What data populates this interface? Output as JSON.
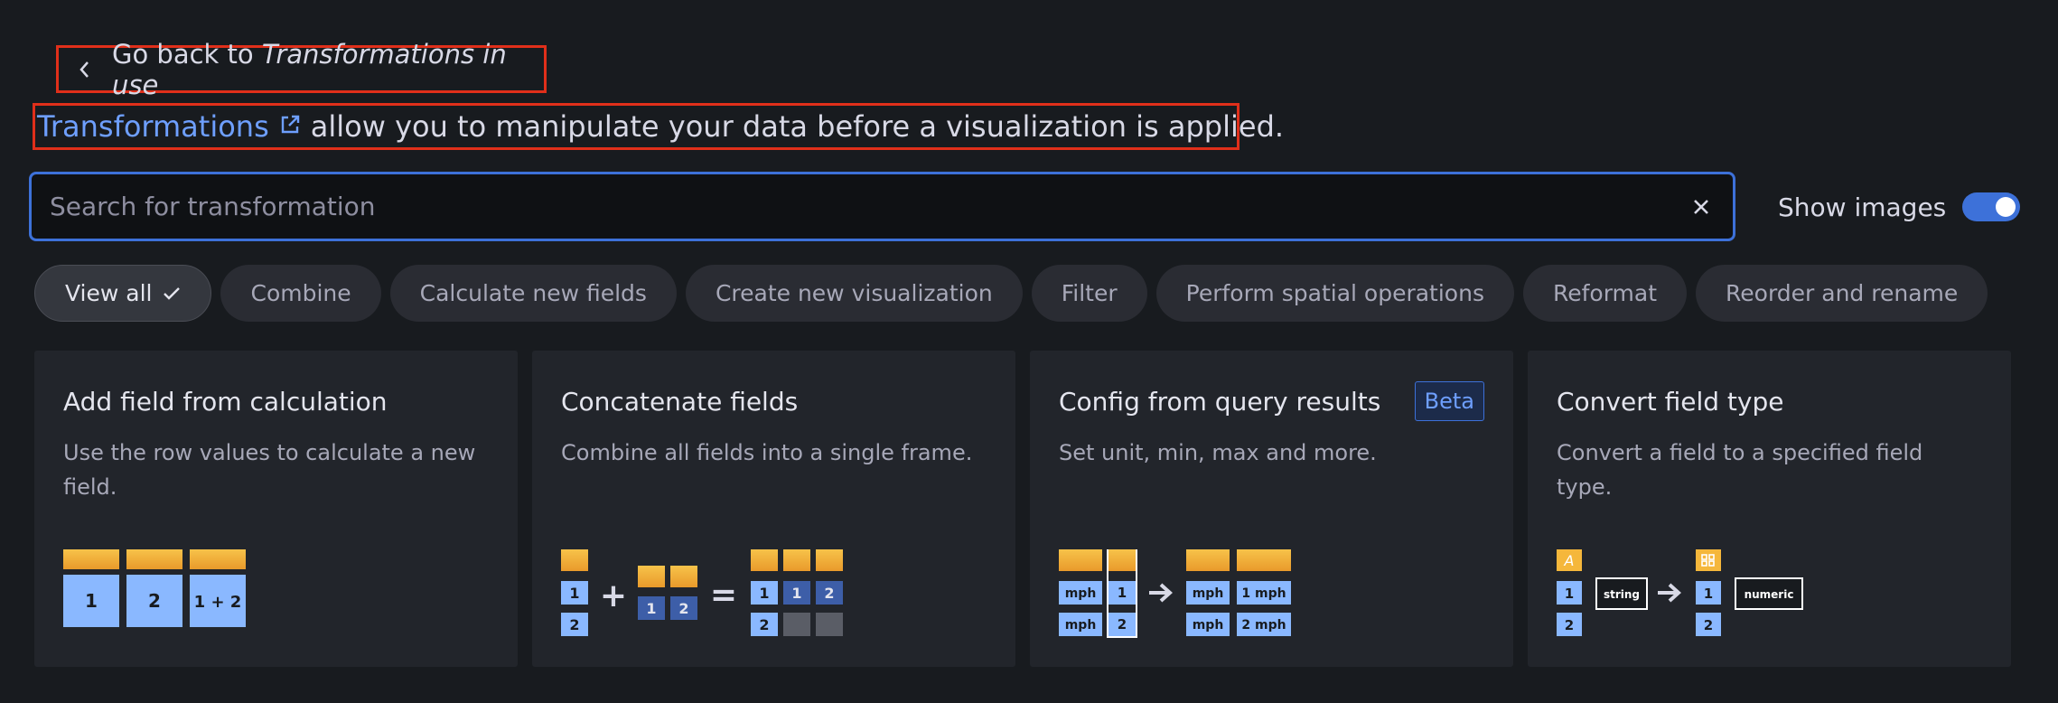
{
  "back_link": {
    "prefix": "Go back to",
    "target": "Transformations in use"
  },
  "intro": {
    "link_text": "Transformations",
    "rest": "allow you to manipulate your data before a visualization is applied."
  },
  "search": {
    "placeholder": "Search for transformation",
    "value": ""
  },
  "show_images": {
    "label": "Show images",
    "enabled": true
  },
  "filters": [
    {
      "label": "View all",
      "active": true
    },
    {
      "label": "Combine"
    },
    {
      "label": "Calculate new fields"
    },
    {
      "label": "Create new visualization"
    },
    {
      "label": "Filter"
    },
    {
      "label": "Perform spatial operations"
    },
    {
      "label": "Reformat"
    },
    {
      "label": "Reorder and rename"
    }
  ],
  "cards": [
    {
      "title": "Add field from calculation",
      "description": "Use the row values to calculate a new field.",
      "illus": {
        "c1": "1",
        "c2": "2",
        "c3": "1 + 2"
      }
    },
    {
      "title": "Concatenate fields",
      "description": "Combine all fields into a single frame.",
      "illus": {
        "a1": "1",
        "a2": "2",
        "b1": "1",
        "b2": "2",
        "r1": "1",
        "r2": "2",
        "r3": "1",
        "r4": "2",
        "plus": "+",
        "eq": "="
      }
    },
    {
      "title": "Config from query results",
      "badge": "Beta",
      "description": "Set unit, min, max and more.",
      "illus": {
        "u1": "mph",
        "u2": "mph",
        "v1": "1",
        "v2": "2",
        "o1": "mph",
        "o2": "mph",
        "o3": "1 mph",
        "o4": "2 mph"
      }
    },
    {
      "title": "Convert field type",
      "description": "Convert a field to a specified field type.",
      "illus": {
        "i1": "1",
        "i2": "2",
        "from": "string",
        "o1": "1",
        "o2": "2",
        "to": "numeric"
      }
    }
  ],
  "colors": {
    "accent": "#3d71d9",
    "link": "#6e9fff",
    "highlight": "#e02f1a",
    "cell_light": "#8ab8ff",
    "cell_dark": "#3d5ea8",
    "header": "#f5b73b"
  }
}
